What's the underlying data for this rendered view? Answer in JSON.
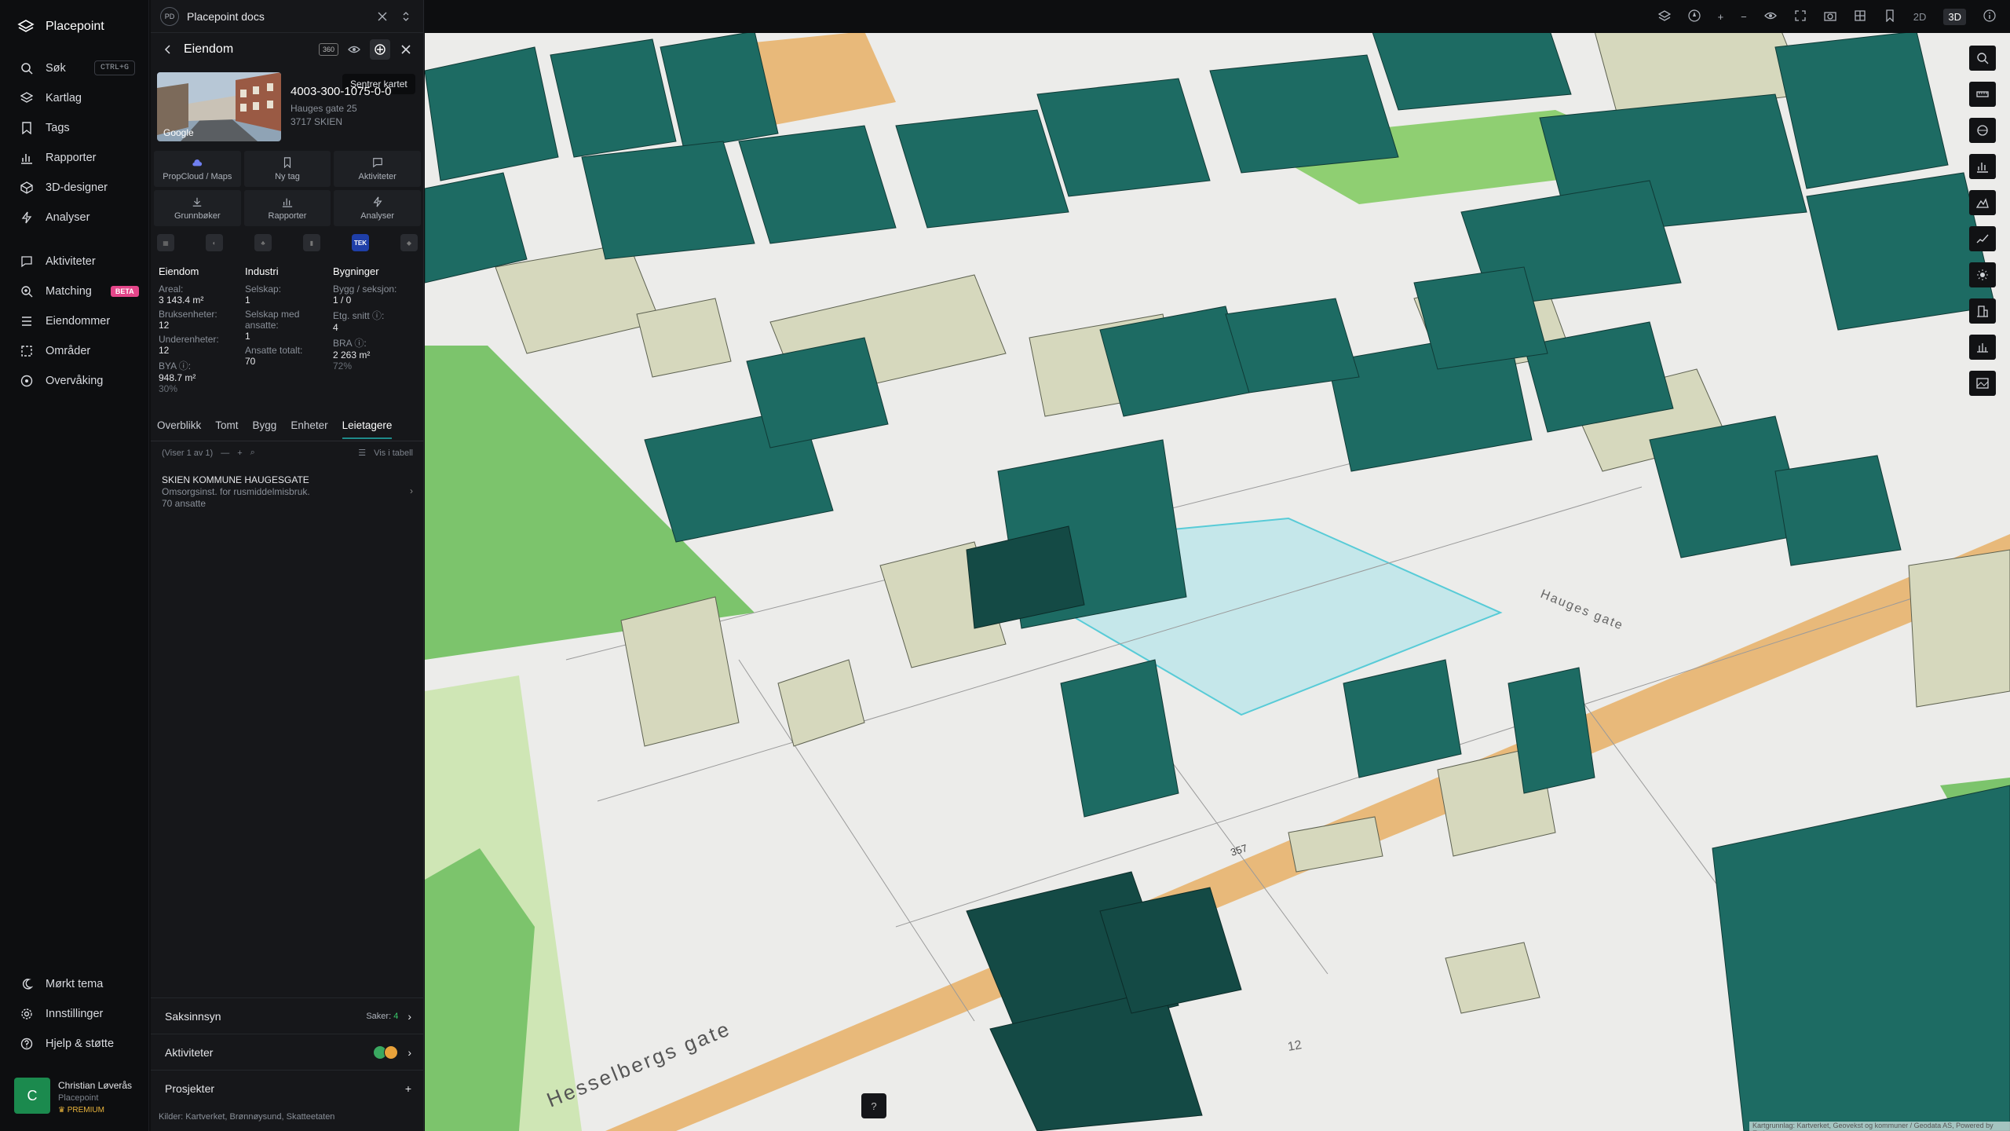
{
  "nav": {
    "brand": "Placepoint",
    "items": [
      {
        "label": "Søk",
        "shortcut": "CTRL+G"
      },
      {
        "label": "Kartlag"
      },
      {
        "label": "Tags"
      },
      {
        "label": "Rapporter"
      },
      {
        "label": "3D-designer"
      },
      {
        "label": "Analyser"
      }
    ],
    "items2": [
      {
        "label": "Aktiviteter"
      },
      {
        "label": "Matching",
        "badge": "BETA"
      },
      {
        "label": "Eiendommer"
      },
      {
        "label": "Områder"
      },
      {
        "label": "Overvåking"
      }
    ],
    "bottom": [
      {
        "label": "Mørkt tema"
      },
      {
        "label": "Innstillinger"
      },
      {
        "label": "Hjelp & støtte"
      }
    ],
    "user": {
      "initial": "C",
      "name": "Christian Løverås",
      "org": "Placepoint",
      "plan": "PREMIUM"
    }
  },
  "panel": {
    "tab_badge": "PD",
    "tab_title": "Placepoint docs",
    "header_title": "Eiendom",
    "badge_360": "360",
    "tooltip": "Sentrer kartet",
    "google": "Google",
    "property_id": "4003-300-1075-0-0",
    "address_line1": "Hauges gate 25",
    "address_line2": "3717 SKIEN",
    "actions": [
      "PropCloud / Maps",
      "Ny tag",
      "Aktiviteter",
      "Grunnbøker",
      "Rapporter",
      "Analyser"
    ],
    "source_tek": "TEK",
    "stats": {
      "eiendom": {
        "title": "Eiendom",
        "areal_label": "Areal:",
        "areal": "3 143.4 m²",
        "bruks_label": "Bruksenheter:",
        "bruks": "12",
        "under_label": "Underenheter:",
        "under": "12",
        "bya_label": "BYA ⓘ:",
        "bya": "948.7 m²",
        "bya_pct": "30%"
      },
      "industri": {
        "title": "Industri",
        "selskap_label": "Selskap:",
        "selskap": "1",
        "med_label": "Selskap med ansatte:",
        "med": "1",
        "ansatte_label": "Ansatte totalt:",
        "ansatte": "70"
      },
      "bygninger": {
        "title": "Bygninger",
        "bygg_label": "Bygg / seksjon:",
        "bygg": "1 / 0",
        "etg_label": "Etg. snitt ⓘ:",
        "etg": "4",
        "bra_label": "BRA ⓘ:",
        "bra": "2 263 m²",
        "bra_pct": "72%"
      }
    },
    "subtabs": [
      "Overblikk",
      "Tomt",
      "Bygg",
      "Enheter",
      "Leietagere"
    ],
    "list_count": "(Viser 1 av 1)",
    "list_table": "Vis i tabell",
    "tenant": {
      "name": "SKIEN KOMMUNE HAUGESGATE",
      "desc": "Omsorgsinst. for rusmiddelmisbruk.",
      "employees": "70 ansatte"
    },
    "saksinnsyn": {
      "label": "Saksinnsyn",
      "meta_label": "Saker:",
      "meta_value": "4"
    },
    "aktiviteter": {
      "label": "Aktiviteter"
    },
    "prosjekter": {
      "label": "Prosjekter"
    },
    "sources_label": "Kilder:",
    "sources": [
      "Kartverket,",
      "Brønnøysund,",
      "Skatteetaten"
    ]
  },
  "map": {
    "street1": "Hesselbergs gate",
    "street2": "Hauges gate",
    "road_number": "357",
    "lot_number": "12",
    "view_2d": "2D",
    "view_3d": "3D",
    "attribution": "Kartgrunnlag: Kartverket, Geovekst og kommuner / Geodata AS, Powered by Esri",
    "colors": {
      "building": "#1d6b63",
      "building_dark": "#123f3b",
      "beige": "#d6d8bd",
      "road": "#e8b97a",
      "grass": "#7cc46c",
      "ground": "#ededeb",
      "highlight": "#bfe7ea"
    }
  }
}
